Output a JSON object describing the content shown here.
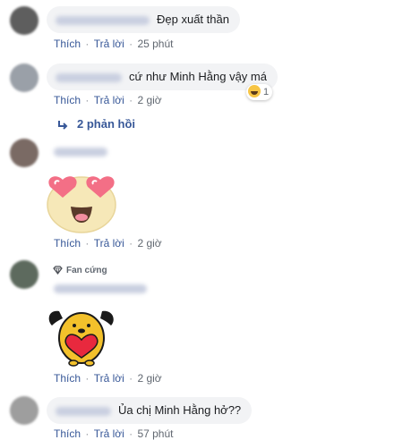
{
  "comments": [
    {
      "text": "Đẹp xuất thần",
      "actions": {
        "like": "Thích",
        "reply": "Trả lời",
        "time": "25 phút"
      }
    },
    {
      "text": "cứ như Minh Hằng vậy má",
      "reaction": {
        "icon": "haha-icon",
        "count": "1"
      },
      "actions": {
        "like": "Thích",
        "reply": "Trả lời",
        "time": "2 giờ"
      },
      "replies": {
        "label": "2 phản hồi",
        "icon": "reply-arrow-icon"
      }
    },
    {
      "sticker": "heart-eyes-sticker",
      "actions": {
        "like": "Thích",
        "reply": "Trả lời",
        "time": "2 giờ"
      }
    },
    {
      "badge": {
        "icon": "diamond-icon",
        "label": "Fan cứng"
      },
      "sticker": "dog-heart-sticker",
      "actions": {
        "like": "Thích",
        "reply": "Trả lời",
        "time": "2 giờ"
      }
    },
    {
      "text": "Ủa chị Minh Hằng hở??",
      "actions": {
        "like": "Thích",
        "reply": "Trả lời",
        "time": "57 phút"
      }
    }
  ],
  "colors": {
    "link": "#385898",
    "bubble": "#f2f3f5",
    "meta": "#606770"
  }
}
